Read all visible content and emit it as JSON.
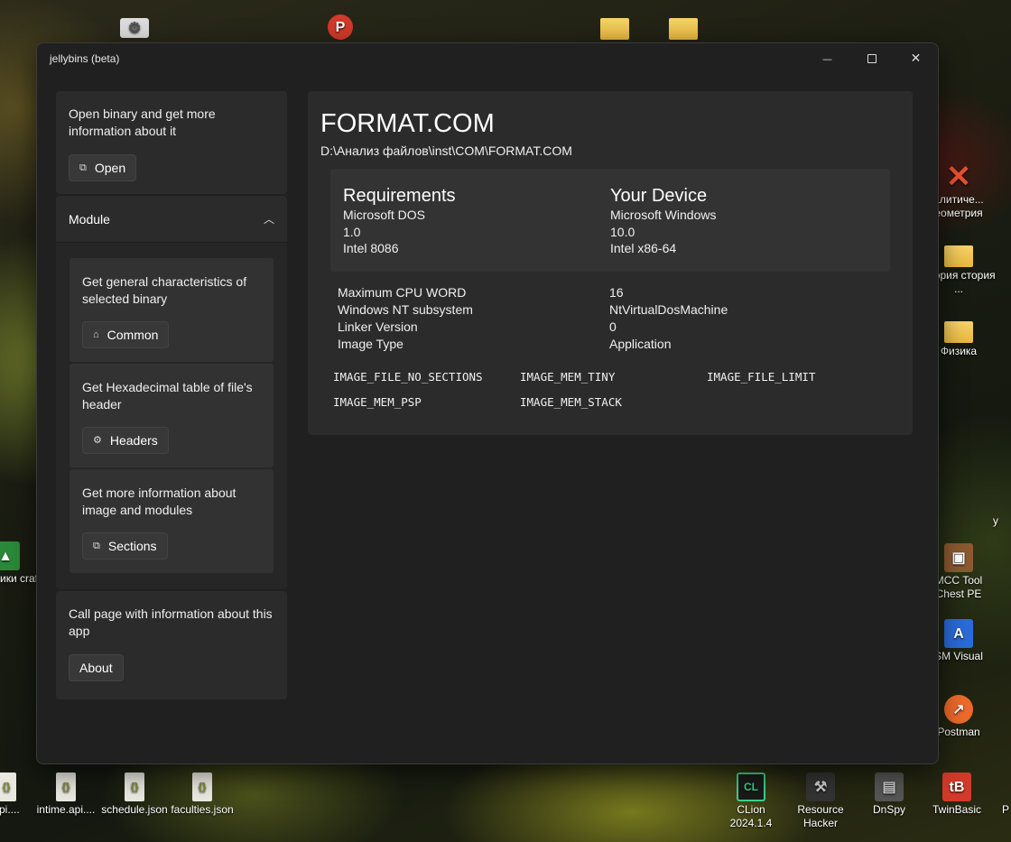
{
  "window": {
    "title": "jellybins (beta)",
    "controls": {
      "minimize": "—",
      "close": "✕"
    }
  },
  "sidebar": {
    "open_card": {
      "description": "Open binary and get more information about it",
      "button": "Open"
    },
    "module": {
      "label": "Module",
      "items": [
        {
          "description": "Get general characteristics of selected binary",
          "button": "Common"
        },
        {
          "description": "Get Hexadecimal table of file's header",
          "button": "Headers"
        },
        {
          "description": "Get more information about image and modules",
          "button": "Sections"
        }
      ]
    },
    "about_card": {
      "description": "Call page with information about this app",
      "button": "About"
    }
  },
  "main": {
    "file_name": "FORMAT.COM",
    "file_path": "D:\\Анализ файлов\\inst\\COM\\FORMAT.COM",
    "requirements": {
      "header": "Requirements",
      "os": "Microsoft DOS",
      "version": "1.0",
      "cpu": "Intel 8086"
    },
    "device": {
      "header": "Your Device",
      "os": "Microsoft Windows",
      "version": "10.0",
      "cpu": "Intel x86-64"
    },
    "properties": [
      {
        "key": "Maximum CPU WORD",
        "value": "16"
      },
      {
        "key": "Windows NT subsystem",
        "value": "NtVirtualDosMachine"
      },
      {
        "key": "Linker Version",
        "value": "0"
      },
      {
        "key": "Image Type",
        "value": "Application"
      }
    ],
    "flags": [
      "IMAGE_FILE_NO_SECTIONS",
      "IMAGE_MEM_TINY",
      "IMAGE_FILE_LIMIT",
      "IMAGE_MEM_PSP",
      "IMAGE_MEM_STACK"
    ]
  },
  "desktop": {
    "right_icons": [
      {
        "label": "алитиче... еометрия",
        "icon": "x-icon"
      },
      {
        "label": "Теория стория ...",
        "icon": "folder-icon"
      },
      {
        "label": "Физика",
        "icon": "folder-icon"
      },
      {
        "label": "MCC Tool Chest PE",
        "icon": "chest-icon"
      },
      {
        "label": "SM Visual",
        "icon": "visual-icon"
      },
      {
        "label": "Postman",
        "icon": "postman-icon"
      }
    ],
    "left_icon": {
      "label": "ики craft"
    },
    "bottom_icons": [
      {
        "label": "api....",
        "icon": "json-icon"
      },
      {
        "label": "intime.api....",
        "icon": "json-icon"
      },
      {
        "label": "schedule.json",
        "icon": "json-icon"
      },
      {
        "label": "faculties.json",
        "icon": "json-icon"
      },
      {
        "label": "CLion 2024.1.4",
        "icon": "clion-icon"
      },
      {
        "label": "Resource Hacker",
        "icon": "resource-hacker-icon"
      },
      {
        "label": "DnSpy",
        "icon": "dnspy-icon"
      },
      {
        "label": "TwinBasic",
        "icon": "twinbasic-icon"
      }
    ],
    "right_edge_text": "у",
    "bottom_right_edge_text": "P"
  }
}
